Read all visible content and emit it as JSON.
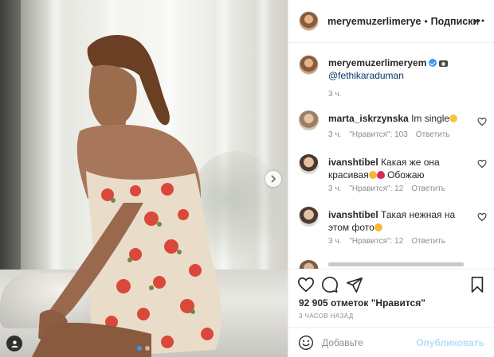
{
  "post": {
    "author": "meryemuzerlimerye",
    "separator": "•",
    "follow_label": "Подписки",
    "carousel": {
      "slides": 2,
      "active_slide": 1
    }
  },
  "caption": {
    "username": "meryemuzerlimeryem",
    "mention": "@fethikaraduman",
    "time": "3 ч."
  },
  "comments": [
    {
      "username": "marta_iskrzynska",
      "text": "Im single",
      "time": "3 ч.",
      "likes": "\"Нравится\": 103",
      "reply_label": "Ответить"
    },
    {
      "username": "ivanshtibel",
      "text": "Какая же она красивая",
      "text_after": "Обожаю",
      "time": "3 ч.",
      "likes": "\"Нравится\": 12",
      "reply_label": "Ответить"
    },
    {
      "username": "ivanshtibel",
      "text": "Такая нежная на этом фото",
      "time": "3 ч.",
      "likes": "\"Нравится\": 12",
      "reply_label": "Ответить"
    }
  ],
  "actions": {
    "likes_text": "92 905 отметок \"Нравится\"",
    "timestamp": "3 ЧАСОВ НАЗАД"
  },
  "add_comment": {
    "placeholder": "Добавьте",
    "publish_label": "Опубликовать"
  },
  "colors": {
    "accent": "#3897f0",
    "publish_disabled": "#b2dffc",
    "secondary_text": "#8e8e8e",
    "mention": "#00376b"
  },
  "icons": [
    "three-dots-icon",
    "verified-badge-icon",
    "heart-icon",
    "comment-icon",
    "share-icon",
    "bookmark-icon",
    "smile-icon",
    "chevron-right-icon",
    "user-tag-icon"
  ]
}
